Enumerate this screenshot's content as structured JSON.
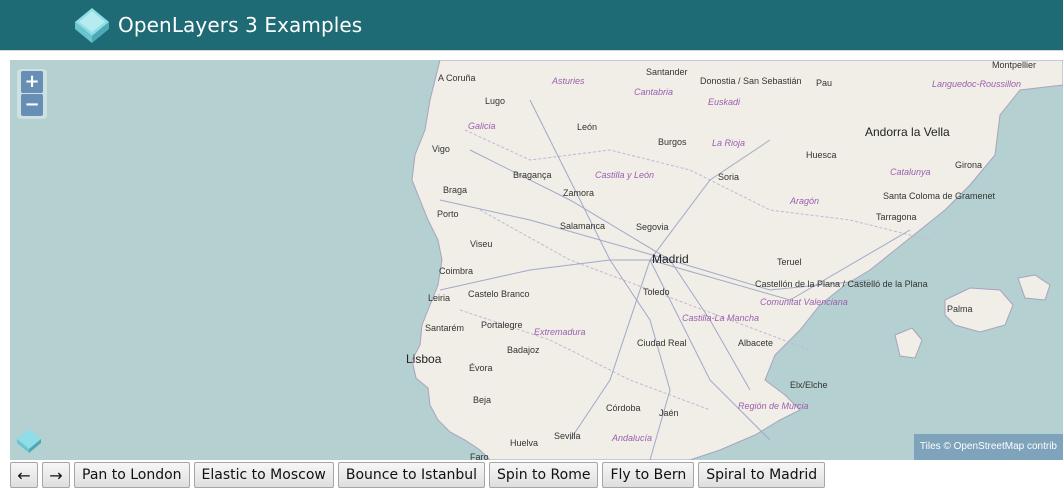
{
  "header": {
    "title": "OpenLayers 3 Examples"
  },
  "map": {
    "zoom_in_label": "+",
    "zoom_out_label": "−",
    "attribution_prefix": "Tiles © ",
    "attribution_link": "OpenStreetMap",
    "attribution_suffix": " contrib",
    "colors": {
      "sea": "#b5d0d0",
      "land": "#f0eee6",
      "accent": "#1f6b75"
    },
    "labels": {
      "a_coruna": "A Coruña",
      "asturies": "Asturies",
      "santander": "Santander",
      "donostia": "Donostia / San Sebastián",
      "pau": "Pau",
      "montpellier": "Montpellier",
      "languedoc": "Languedoc-Roussillon",
      "lugo": "Lugo",
      "cantabria": "Cantabria",
      "euskadi": "Euskadi",
      "galicia": "Galicia",
      "leon": "León",
      "andorra": "Andorra la Vella",
      "burgos": "Burgos",
      "la_rioja": "La Rioja",
      "huesca": "Huesca",
      "vigo": "Vigo",
      "girona": "Girona",
      "braganca": "Bragança",
      "castilla_y_leon": "Castilla y León",
      "soria": "Soria",
      "catalunya": "Catalunya",
      "braga": "Braga",
      "zamora": "Zamora",
      "aragon": "Aragón",
      "santa_coloma": "Santa Coloma de Gramenet",
      "porto": "Porto",
      "tarragona": "Tarragona",
      "salamanca": "Salamanca",
      "segovia": "Segovia",
      "viseu": "Viseu",
      "madrid": "Madrid",
      "teruel": "Teruel",
      "coimbra": "Coimbra",
      "castellon": "Castellón de la Plana / Castelló de la Plana",
      "toledo": "Toledo",
      "leiria": "Leiria",
      "castelo_branco": "Castelo Branco",
      "comunitat": "Comunitat Valenciana",
      "palma": "Palma",
      "castilla_la_mancha": "Castilla-La Mancha",
      "santarem": "Santarém",
      "portalegre": "Portalegre",
      "extremadura": "Extremadura",
      "ciudad_real": "Ciudad Real",
      "albacete": "Albacete",
      "badajoz": "Badajoz",
      "lisboa": "Lisboa",
      "evora": "Évora",
      "elx": "Elx/Elche",
      "beja": "Beja",
      "region_murcia": "Región de Murcia",
      "cordoba": "Córdoba",
      "jaen": "Jaén",
      "sevilla": "Sevilla",
      "huelva": "Huelva",
      "andalucia": "Andalucía",
      "faro": "Faro"
    }
  },
  "controls": {
    "back_label": "←",
    "forward_label": "→",
    "buttons": [
      "Pan to London",
      "Elastic to Moscow",
      "Bounce to Istanbul",
      "Spin to Rome",
      "Fly to Bern",
      "Spiral to Madrid"
    ]
  }
}
